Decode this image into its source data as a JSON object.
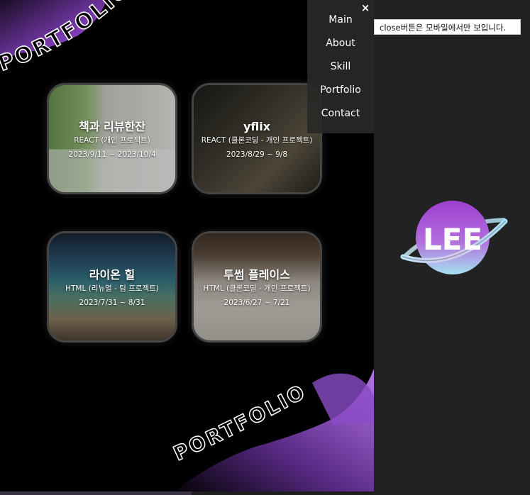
{
  "page": {
    "logo_text": "LEE",
    "marquee_text": "PORTFOLIO"
  },
  "nav": {
    "close_symbol": "×",
    "items": [
      {
        "label": "Main"
      },
      {
        "label": "About"
      },
      {
        "label": "Skill"
      },
      {
        "label": "Portfolio"
      },
      {
        "label": "Contact"
      }
    ]
  },
  "tooltip": {
    "text": "close버튼은 모바일에서만 보입니다."
  },
  "projects": [
    {
      "title": "책과 리뷰한잔",
      "subtitle": "REACT (개인 프로젝트)",
      "date": "2023/9/11 ~ 2023/10/4"
    },
    {
      "title": "yflix",
      "subtitle": "REACT (클론코딩 - 개인 프로젝트)",
      "date": "2023/8/29 ~ 9/8"
    },
    {
      "title": "라이온 힐",
      "subtitle": "HTML (리뉴얼 - 팀 프로젝트)",
      "date": "2023/7/31 ~ 8/31"
    },
    {
      "title": "투썸 플레이스",
      "subtitle": "HTML (클론코딩 - 개인 프로젝트)",
      "date": "2023/6/27 ~ 7/21"
    }
  ],
  "colors": {
    "accent_purple": "#9b4fd6",
    "logo_gradient_top": "#9d3fd0",
    "logo_gradient_bottom": "#a6e1f2",
    "nav_bg": "#282828"
  }
}
